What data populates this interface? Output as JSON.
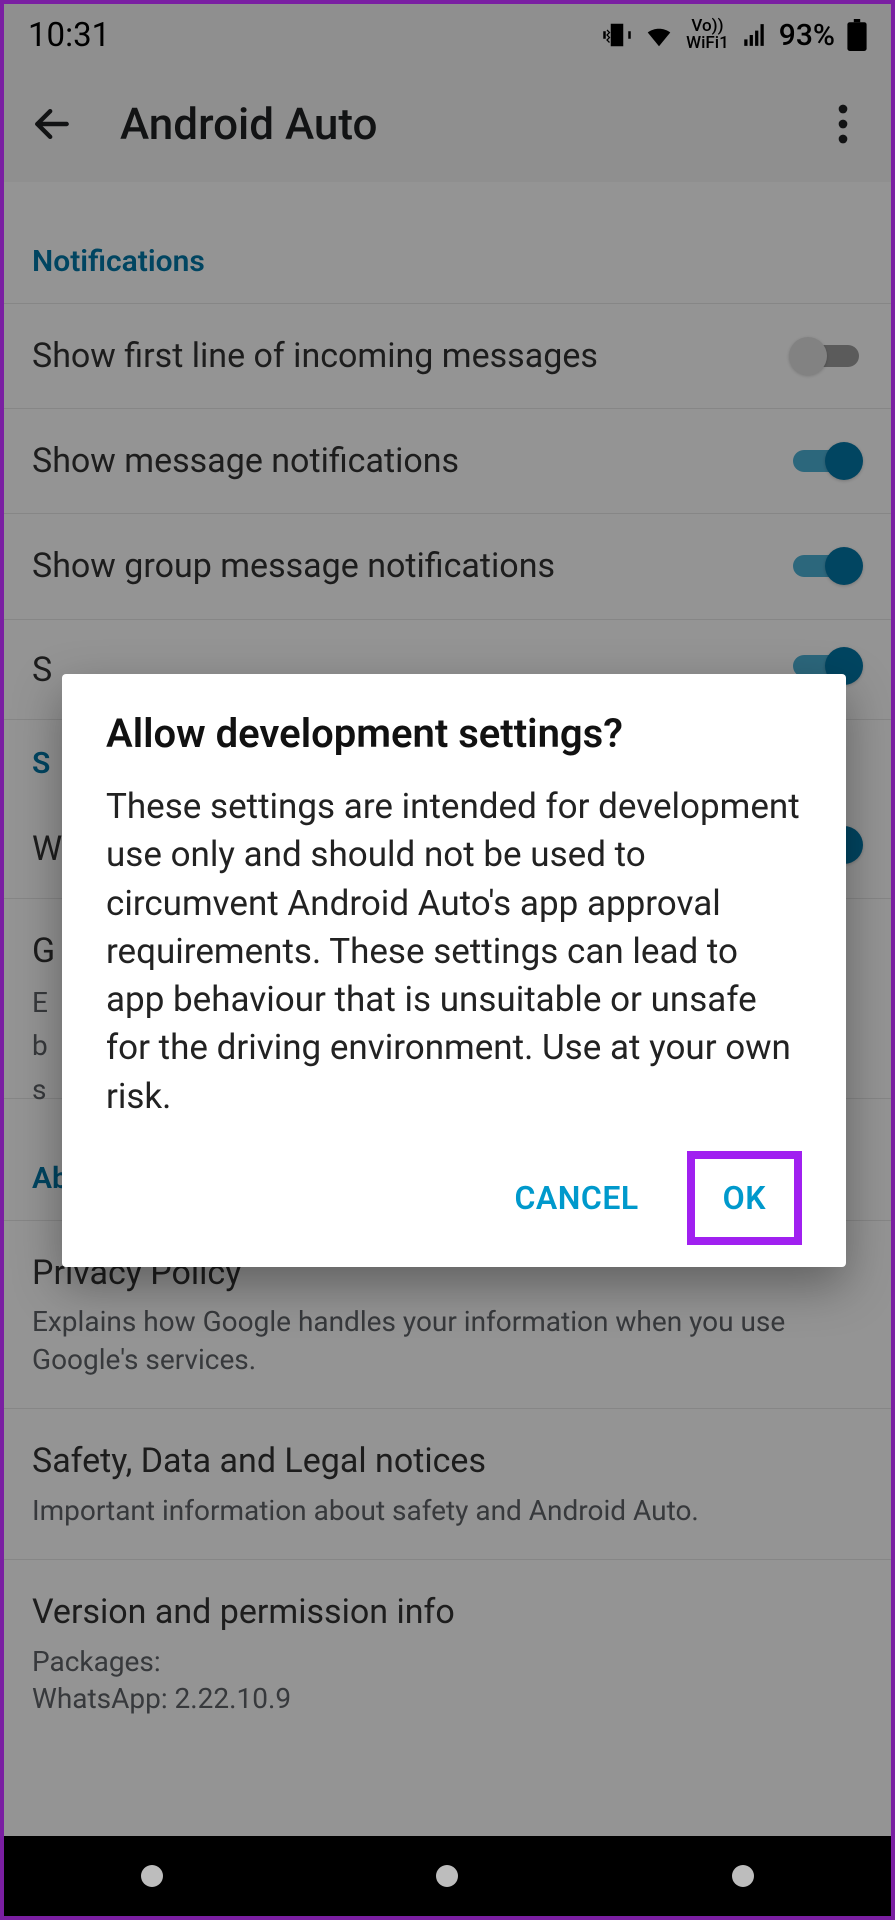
{
  "status": {
    "time": "10:31",
    "wifi_label": "WiFi1",
    "vo_label": "Vo))",
    "battery_pct": "93%"
  },
  "appbar": {
    "title": "Android Auto"
  },
  "sections": {
    "notifications": {
      "header": "Notifications",
      "items": [
        {
          "label": "Show first line of incoming messages"
        },
        {
          "label": "Show message notifications"
        },
        {
          "label": "Show group message notifications"
        }
      ]
    },
    "partial": {
      "r0": "S",
      "sys_header_initial": "S",
      "r1": "W",
      "r2_label": "G",
      "r2_sub": "E\nb\ns"
    },
    "about": {
      "header": "About",
      "privacy": {
        "label": "Privacy Policy",
        "sub": "Explains how Google handles your information when you use Google's services."
      },
      "safety": {
        "label": "Safety, Data and Legal notices",
        "sub": "Important information about safety and Android Auto."
      },
      "version": {
        "label": "Version and permission info",
        "sub": "Packages:\nWhatsApp: 2.22.10.9"
      }
    }
  },
  "dialog": {
    "title": "Allow development settings?",
    "body": "These settings are intended for development use only and should not be used to circumvent Android Auto's app approval requirements. These settings can lead to app behaviour that is unsuitable or unsafe for the driving environment. Use at your own risk.",
    "cancel": "CANCEL",
    "ok": "OK"
  }
}
